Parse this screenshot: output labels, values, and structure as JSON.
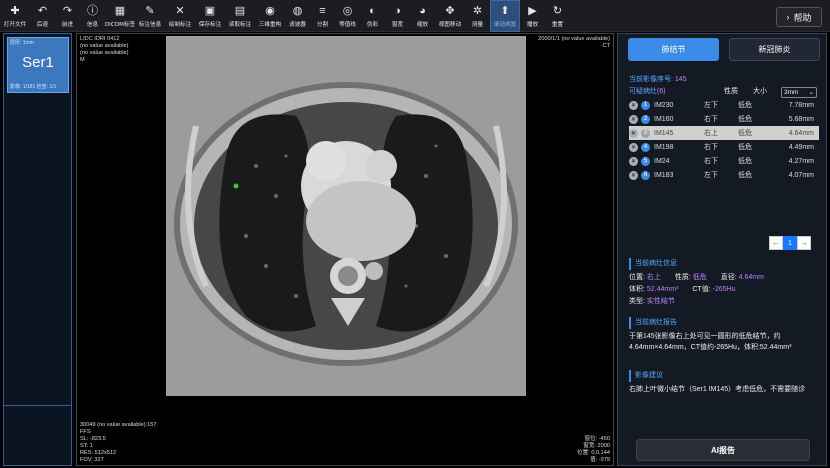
{
  "toolbar": {
    "items": [
      {
        "label": "打开文件",
        "icon": "plus-icon"
      },
      {
        "label": "后退",
        "icon": "undo-icon"
      },
      {
        "label": "前进",
        "icon": "redo-icon"
      },
      {
        "label": "信息",
        "icon": "info-icon"
      },
      {
        "label": "DICOM标签",
        "icon": "grid-icon"
      },
      {
        "label": "标注信息",
        "icon": "pencil-icon"
      },
      {
        "label": "绘制标注",
        "icon": "draw-icon"
      },
      {
        "label": "保存标注",
        "icon": "save-icon"
      },
      {
        "label": "读取标注",
        "icon": "load-icon"
      },
      {
        "label": "三维重构",
        "icon": "eye-icon"
      },
      {
        "label": "滤波器",
        "icon": "filter-icon"
      },
      {
        "label": "分割",
        "icon": "layers-icon"
      },
      {
        "label": "等值线",
        "icon": "contour-icon"
      },
      {
        "label": "伪彩",
        "icon": "palette-icon"
      },
      {
        "label": "窗宽",
        "icon": "contrast-icon"
      },
      {
        "label": "缩放",
        "icon": "globe-icon"
      },
      {
        "label": "视图移动",
        "icon": "move-icon"
      },
      {
        "label": "测量",
        "icon": "gear-icon"
      },
      {
        "label": "滚动浏览",
        "icon": "arrow-up-icon",
        "active": true
      },
      {
        "label": "播放",
        "icon": "play-icon"
      },
      {
        "label": "重置",
        "icon": "refresh-icon"
      }
    ],
    "help_label": "帮助"
  },
  "series": {
    "thumb_top": "层厚: 1mm",
    "name": "Ser1",
    "thumb_bottom": "影像: 1/181  检查: 1/1"
  },
  "viewer": {
    "top_left": "LIDC IDRI 0412\n(no value available)\n(no value available)\nM",
    "top_right": "2000/1/1 (no value available)\nCT",
    "bottom_left": "30049 (no value available):157\nFFS\nSL: -823.5\nST: 1\nRES: 512x512\nFOV: 327",
    "bottom_right": "窗位: -450\n窗宽: 2000\n位置: 0,0,144\n值: -979"
  },
  "panel": {
    "tab_nodule": "肺结节",
    "tab_covid": "新冠肺炎",
    "current_image_label": "当前影像序号:",
    "current_image_value": "145",
    "suspicious_label": "可疑病灶",
    "suspicious_count": "(6)",
    "col_risk": "性质",
    "col_size": "大小",
    "size_select": "3mm",
    "nodules": [
      {
        "n": "1",
        "im": "IM230",
        "loc": "左下",
        "risk": "低危",
        "size": "7.78mm"
      },
      {
        "n": "2",
        "im": "IM160",
        "loc": "右下",
        "risk": "低危",
        "size": "5.68mm"
      },
      {
        "n": "3",
        "im": "IM145",
        "loc": "右上",
        "risk": "低危",
        "size": "4.64mm",
        "selected": true
      },
      {
        "n": "4",
        "im": "IM198",
        "loc": "右下",
        "risk": "低危",
        "size": "4.49mm"
      },
      {
        "n": "5",
        "im": "IM24",
        "loc": "右下",
        "risk": "低危",
        "size": "4.27mm"
      },
      {
        "n": "6",
        "im": "IM183",
        "loc": "左下",
        "risk": "低危",
        "size": "4.07mm"
      }
    ],
    "pager": {
      "prev": "←",
      "current": "1",
      "next": "→"
    },
    "info_title": "当前病灶信息",
    "info": {
      "pos_label": "位置:",
      "pos_value": "右上",
      "risk_label": "性质:",
      "risk_value": "低危",
      "diam_label": "直径:",
      "diam_value": "4.64mm",
      "vol_label": "体积:",
      "vol_value": "52.44mm³",
      "ct_label": "CT值:",
      "ct_value": "-265Hu",
      "type_label": "类型:",
      "type_value": "实性结节"
    },
    "report_title": "当前病灶报告",
    "report_text": "于第145张影像右上处可见一圆形的低危结节，约4.64mm×4.64mm，CT值约-265Hu，体积:52.44mm³",
    "advice_title": "影像建议",
    "advice_text": "右肺上叶微小结节（Ser1 IM145）考虑低危，不需要随诊",
    "ai_button": "AI报告"
  },
  "colors": {
    "accent": "#3b8ce8",
    "label_blue": "#58a6ff",
    "value_purple": "#c080ff"
  }
}
